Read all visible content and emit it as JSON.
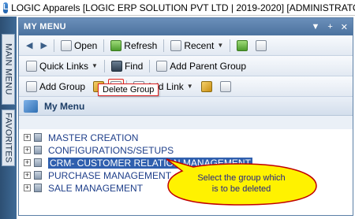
{
  "window": {
    "title": "LOGIC Apparels [LOGIC ERP SOLUTION PVT LTD | 2019-2020] [ADMINISTRATOR]"
  },
  "sidebar": {
    "tabs": [
      {
        "label": "MAIN MENU"
      },
      {
        "label": "FAVORITES"
      }
    ]
  },
  "panel": {
    "title": "MY MENU",
    "controls": [
      "▼",
      "+",
      "✕"
    ]
  },
  "toolbar1": {
    "back": "◀",
    "forward": "▶",
    "open": "Open",
    "refresh": "Refresh",
    "recent": "Recent"
  },
  "toolbar2": {
    "quick_links": "Quick Links",
    "find": "Find",
    "add_parent_group": "Add Parent Group"
  },
  "toolbar3": {
    "add_group": "Add Group",
    "add_link": "Add Link"
  },
  "tooltip": {
    "text": "Delete Group"
  },
  "mymenu": {
    "label": "My Menu"
  },
  "tree": {
    "items": [
      {
        "label": "MASTER CREATION"
      },
      {
        "label": "CONFIGURATIONS/SETUPS"
      },
      {
        "label": "CRM- CUSTOMER RELATION MANAGEMENT"
      },
      {
        "label": "PURCHASE MANAGEMENT"
      },
      {
        "label": "SALE MANAGEMENT"
      }
    ]
  },
  "callout": {
    "line1": "Select  the  group  which",
    "line2": "is  to  be  deleted"
  },
  "colors": {
    "callout_fill": "#fff200",
    "callout_stroke": "#c00000",
    "selected_row": "#2f5fae"
  }
}
